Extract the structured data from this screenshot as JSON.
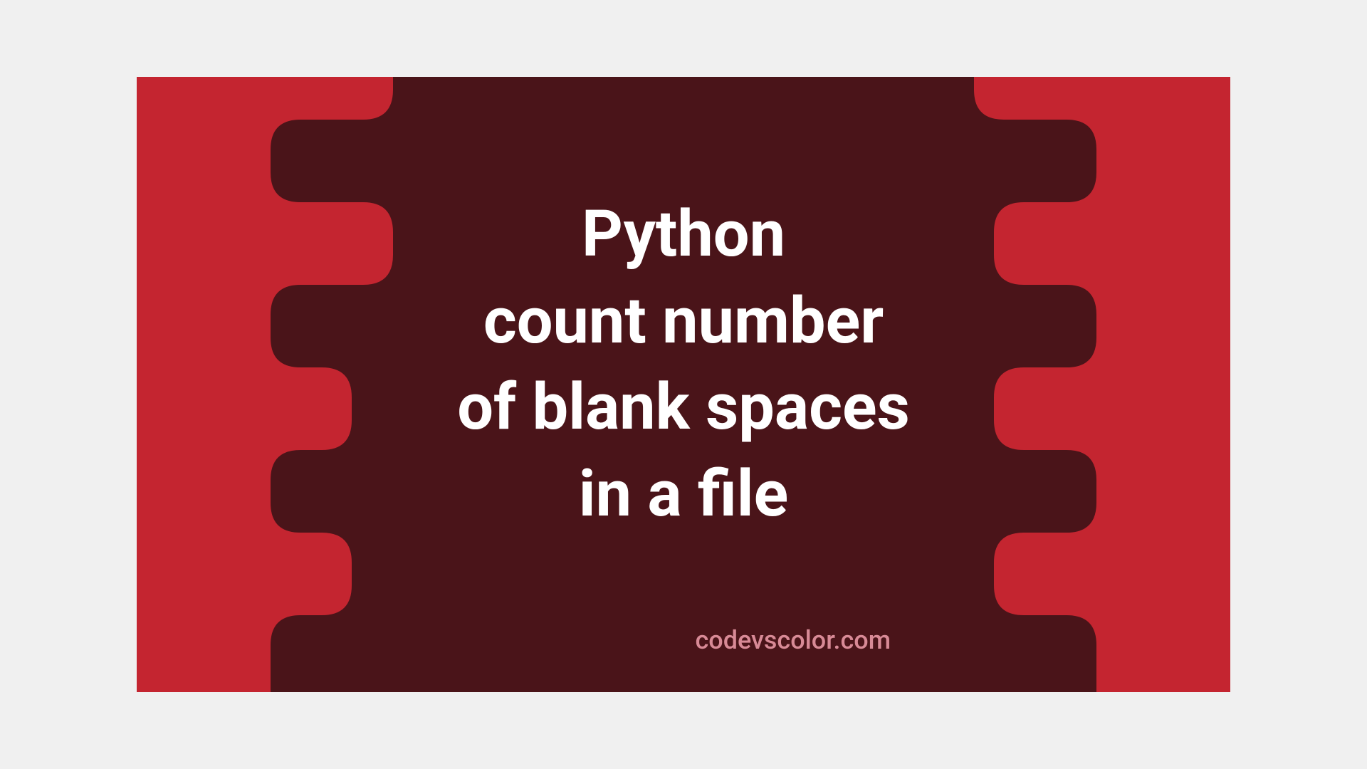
{
  "banner": {
    "title_line1": "Python",
    "title_line2": "count number",
    "title_line3": "of blank spaces",
    "title_line4": "in a file",
    "watermark": "codevscolor.com"
  },
  "colors": {
    "background_red": "#c42530",
    "blob_dark": "#4a1419",
    "text_white": "#ffffff",
    "watermark_pink": "#d88a96"
  }
}
